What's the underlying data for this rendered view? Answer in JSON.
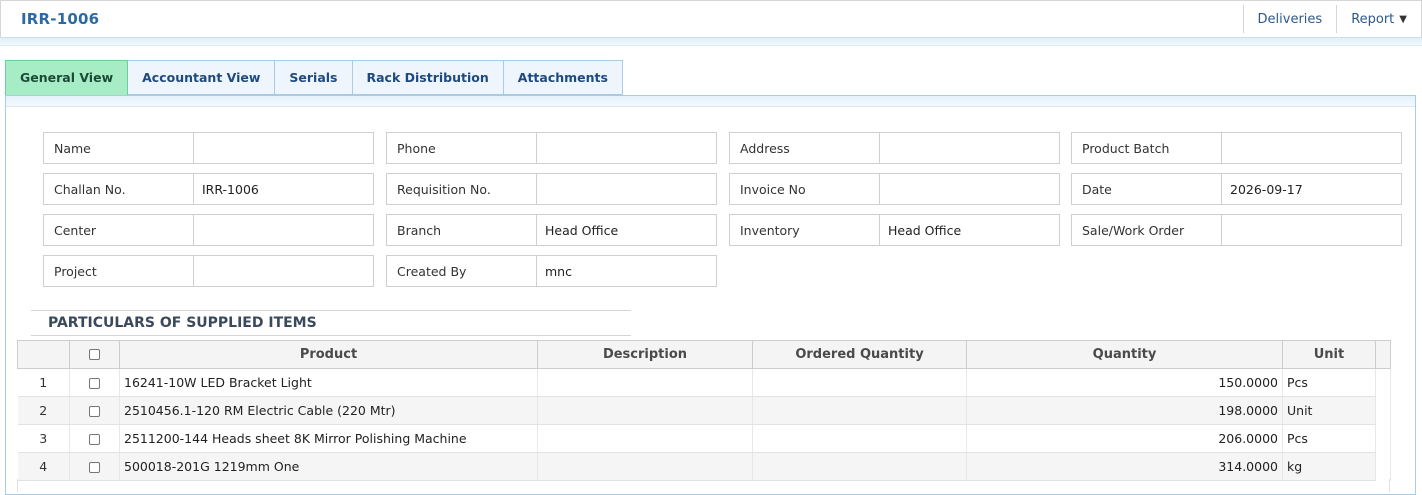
{
  "header": {
    "title": "IRR-1006",
    "actions": [
      {
        "label": "Deliveries"
      },
      {
        "label": "Report"
      }
    ]
  },
  "tabs": [
    {
      "label": "General View",
      "active": true
    },
    {
      "label": "Accountant View"
    },
    {
      "label": "Serials"
    },
    {
      "label": "Rack Distribution"
    },
    {
      "label": "Attachments"
    }
  ],
  "fields": {
    "name": {
      "label": "Name",
      "value": ""
    },
    "phone": {
      "label": "Phone",
      "value": ""
    },
    "address": {
      "label": "Address",
      "value": ""
    },
    "product_batch": {
      "label": "Product Batch",
      "value": ""
    },
    "challan_no": {
      "label": "Challan No.",
      "value": "IRR-1006"
    },
    "requisition_no": {
      "label": "Requisition No.",
      "value": ""
    },
    "invoice_no": {
      "label": "Invoice No",
      "value": ""
    },
    "date": {
      "label": "Date",
      "value": "2026-09-17"
    },
    "center": {
      "label": "Center",
      "value": ""
    },
    "branch": {
      "label": "Branch",
      "value": "Head Office"
    },
    "inventory": {
      "label": "Inventory",
      "value": "Head Office"
    },
    "sale_work_order": {
      "label": "Sale/Work Order",
      "value": ""
    },
    "project": {
      "label": "Project",
      "value": ""
    },
    "created_by": {
      "label": "Created By",
      "value": "mnc"
    }
  },
  "section": {
    "title": "PARTICULARS OF SUPPLIED ITEMS"
  },
  "table": {
    "columns": [
      "Product",
      "Description",
      "Ordered Quantity",
      "Quantity",
      "Unit"
    ],
    "rows": [
      {
        "no": "1",
        "product": "16241-10W LED Bracket Light",
        "description": "",
        "ordered": "",
        "quantity": "150.0000",
        "unit": "Pcs"
      },
      {
        "no": "2",
        "product": "2510456.1-120 RM Electric Cable (220 Mtr)",
        "description": "",
        "ordered": "",
        "quantity": "198.0000",
        "unit": "Unit"
      },
      {
        "no": "3",
        "product": "2511200-144 Heads sheet 8K Mirror Polishing Machine",
        "description": "",
        "ordered": "",
        "quantity": "206.0000",
        "unit": "Pcs"
      },
      {
        "no": "4",
        "product": "500018-201G 1219mm One",
        "description": "",
        "ordered": "",
        "quantity": "314.0000",
        "unit": "kg"
      }
    ]
  },
  "colors": {
    "title": "#2d6aa3",
    "active_tab": "#a6edc6",
    "tab_border": "#a9cbe6"
  }
}
